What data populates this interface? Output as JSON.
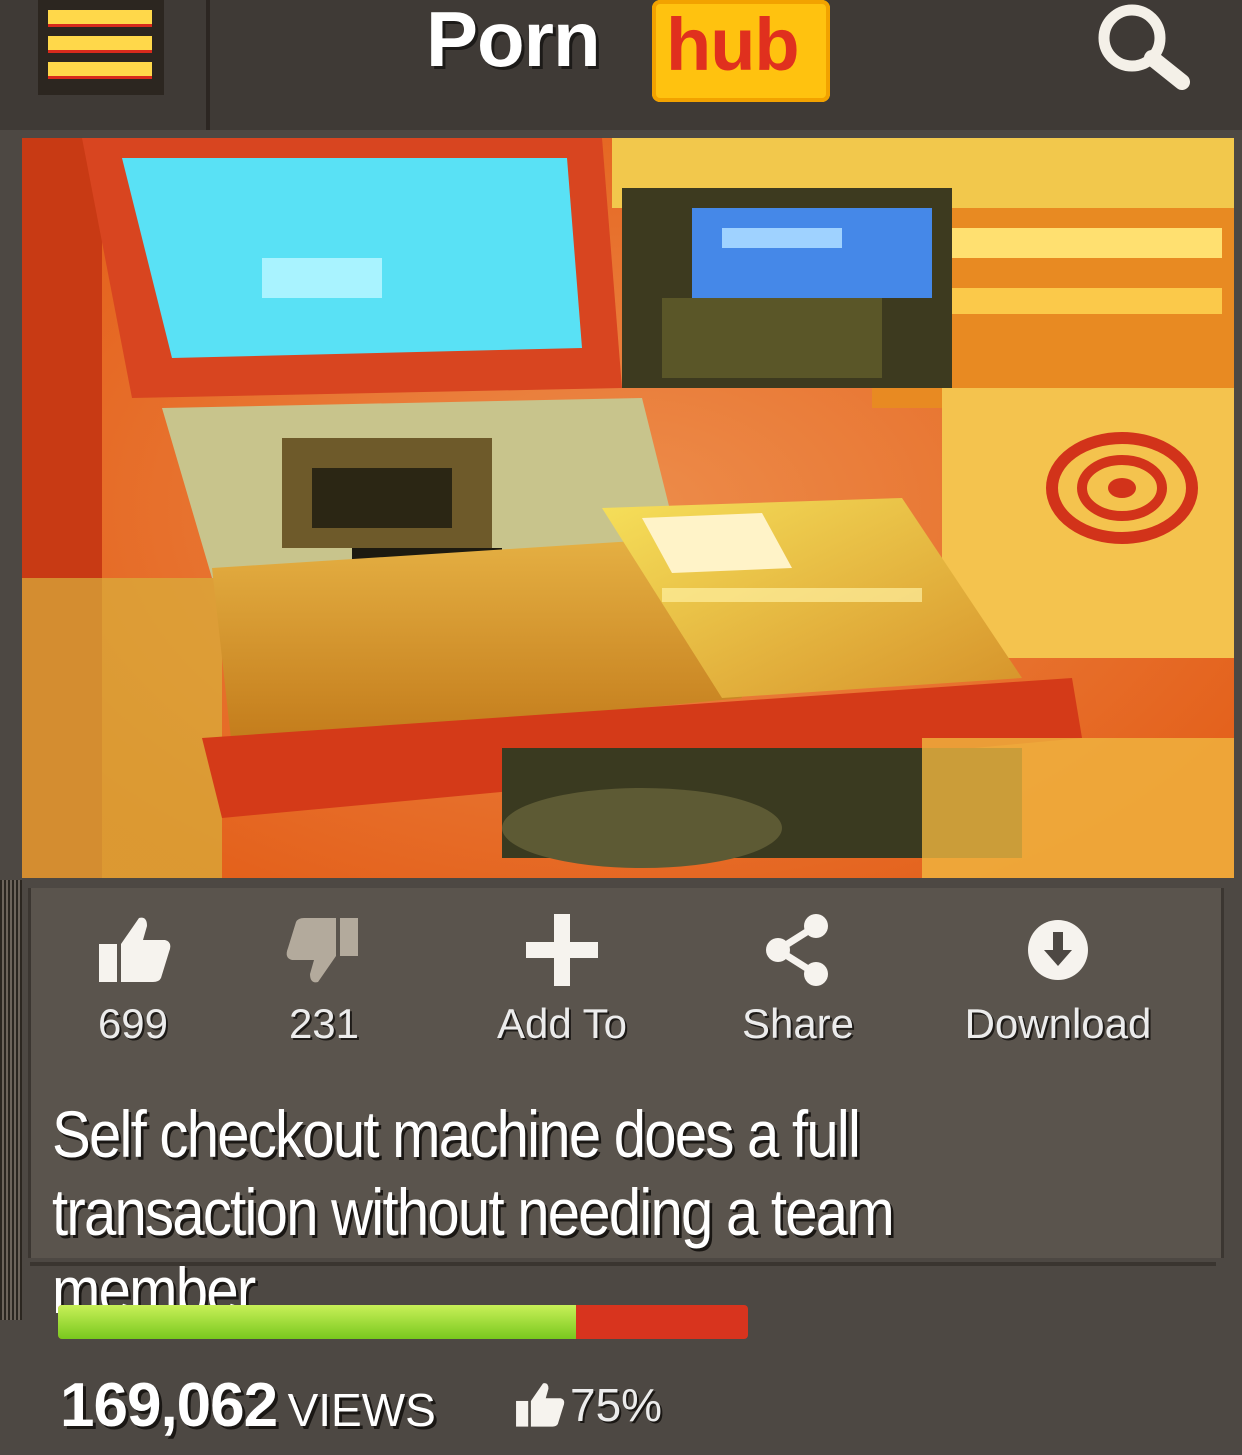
{
  "header": {
    "logo_left": "Porn",
    "logo_right": "hub",
    "menu_icon": "hamburger-menu-icon",
    "search_icon": "search-icon"
  },
  "video": {
    "thumbnail": "self-checkout-machine-photo"
  },
  "actions": [
    {
      "icon": "thumbs-up-icon",
      "label": "699"
    },
    {
      "icon": "thumbs-down-icon",
      "label": "231"
    },
    {
      "icon": "plus-icon",
      "label": "Add To"
    },
    {
      "icon": "share-icon",
      "label": "Share"
    },
    {
      "icon": "download-icon",
      "label": "Download"
    }
  ],
  "title": "Self checkout machine does a full transaction without needing a team member",
  "stats": {
    "views": "169,062",
    "views_label": "VIEWS",
    "rating": "75%",
    "rating_fraction": 0.75
  },
  "colors": {
    "brand_orange": "#ffc20f",
    "brand_text": "#e0301e",
    "like_green": "#8fd42a",
    "dislike_red": "#d8341e"
  }
}
